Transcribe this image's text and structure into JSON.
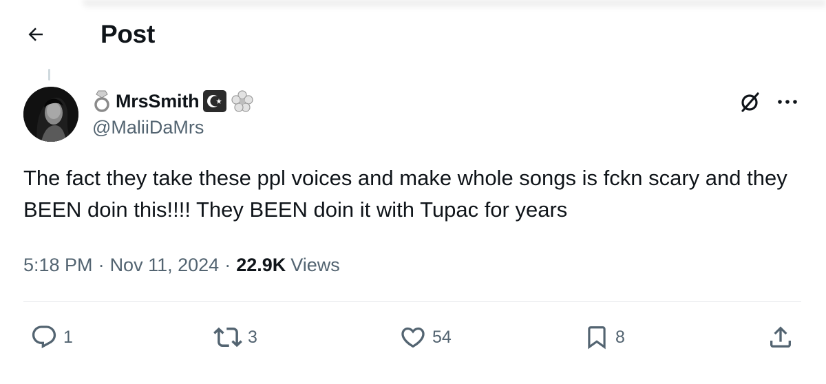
{
  "header": {
    "title": "Post",
    "back_icon": "arrow-left-icon"
  },
  "author": {
    "display_name": "MrsSmith",
    "handle": "@MaliiDaMrs",
    "prefix_emoji": "💍",
    "badge_emojis": [
      "☪️",
      "🌸"
    ],
    "avatar_icon": "profile-photo"
  },
  "tweet": {
    "text": "The fact they take these ppl voices and make whole songs is fckn scary and they BEEN doin this!!!! They BEEN doin it with Tupac for years"
  },
  "meta": {
    "time": "5:18 PM",
    "date": "Nov 11, 2024",
    "views_count": "22.9K",
    "views_label": "Views",
    "separator": "·"
  },
  "actions": {
    "replies": "1",
    "reposts": "3",
    "likes": "54",
    "bookmarks": "8"
  },
  "icons": {
    "grok": "grok-icon",
    "more": "more-dots-icon",
    "reply": "reply-icon",
    "repost": "repost-icon",
    "like": "heart-icon",
    "bookmark": "bookmark-icon",
    "share": "share-icon"
  },
  "colors": {
    "text": "#0f1419",
    "secondary": "#536471",
    "divider": "#e6e9eb"
  }
}
